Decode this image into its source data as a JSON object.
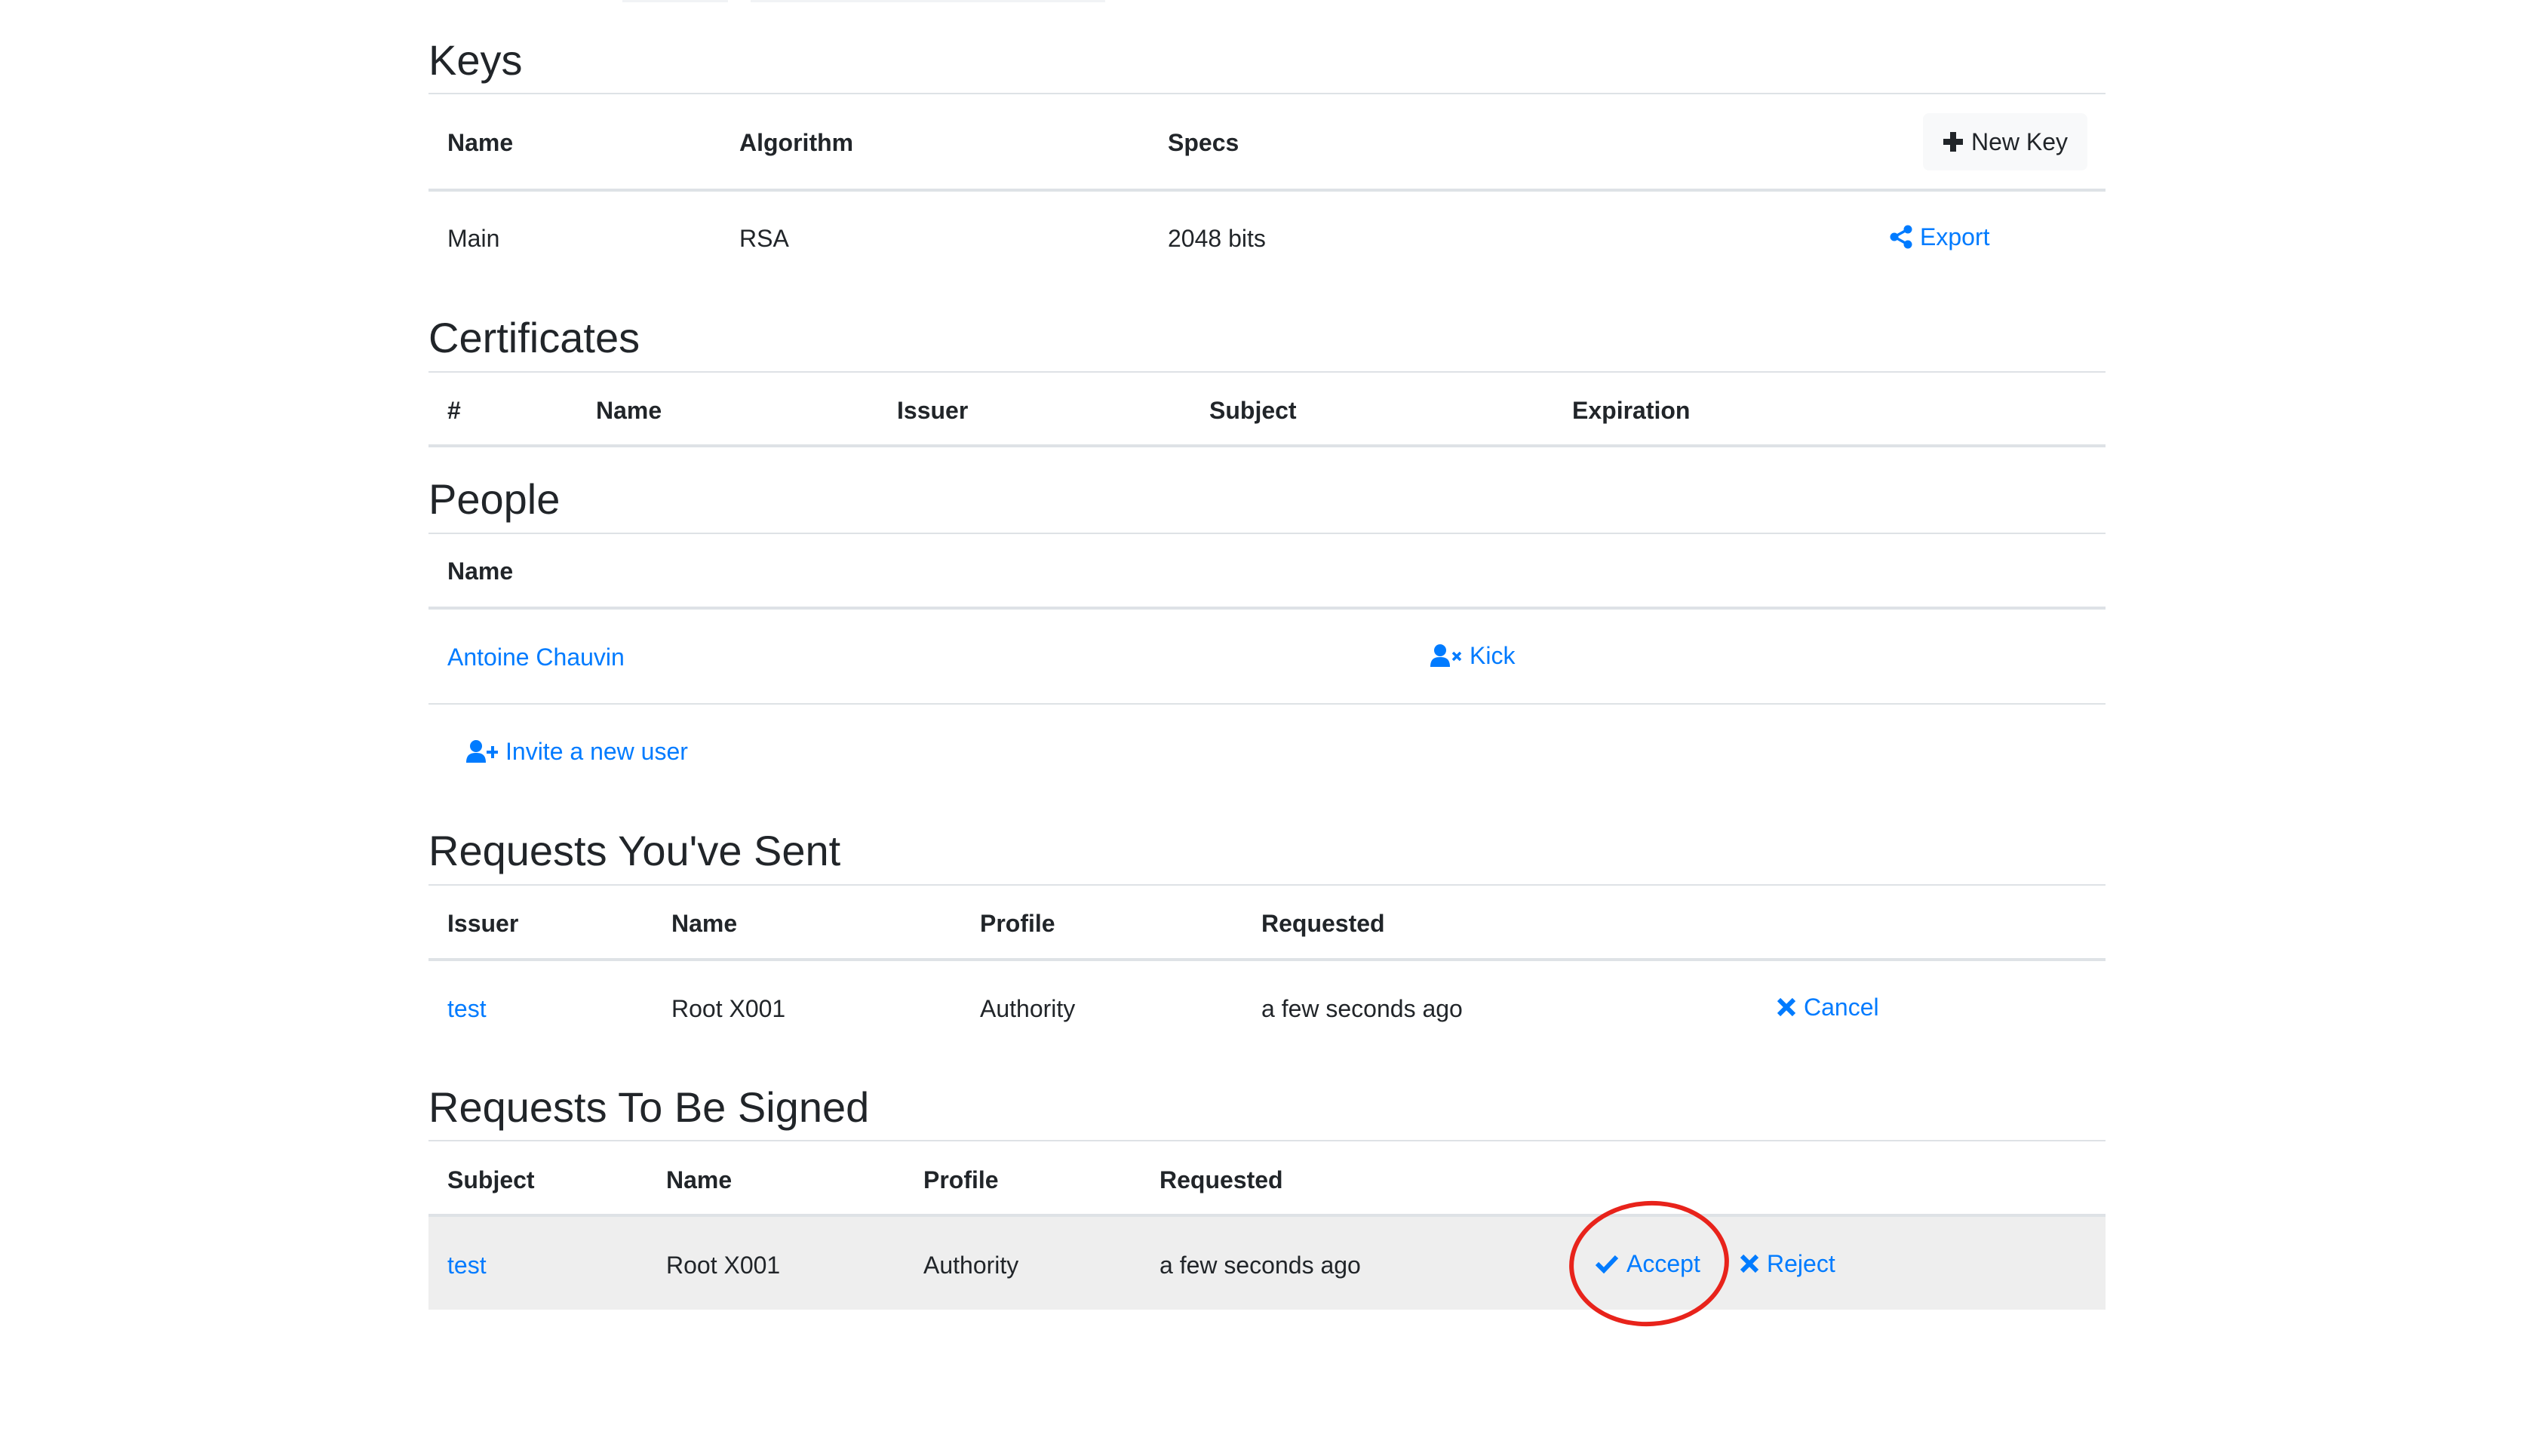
{
  "keys": {
    "title": "Keys",
    "columns": [
      "Name",
      "Algorithm",
      "Specs"
    ],
    "new_key_label": "New Key",
    "rows": [
      {
        "name": "Main",
        "algorithm": "RSA",
        "specs": "2048 bits",
        "action": "Export"
      }
    ]
  },
  "certificates": {
    "title": "Certificates",
    "columns": [
      "#",
      "Name",
      "Issuer",
      "Subject",
      "Expiration"
    ]
  },
  "people": {
    "title": "People",
    "columns": [
      "Name"
    ],
    "rows": [
      {
        "name": "Antoine Chauvin",
        "action": "Kick"
      }
    ],
    "invite_label": "Invite a new user"
  },
  "requests_sent": {
    "title": "Requests You've Sent",
    "columns": [
      "Issuer",
      "Name",
      "Profile",
      "Requested"
    ],
    "rows": [
      {
        "issuer": "test",
        "name": "Root X001",
        "profile": "Authority",
        "requested": "a few seconds ago",
        "action": "Cancel"
      }
    ]
  },
  "requests_to_sign": {
    "title": "Requests To Be Signed",
    "columns": [
      "Subject",
      "Name",
      "Profile",
      "Requested"
    ],
    "rows": [
      {
        "subject": "test",
        "name": "Root X001",
        "profile": "Authority",
        "requested": "a few seconds ago",
        "accept": "Accept",
        "reject": "Reject"
      }
    ]
  },
  "colors": {
    "link": "#007bff",
    "text": "#212529",
    "border": "#dee2e6",
    "highlight_row": "#eeeeee",
    "annotation": "#e8231b"
  }
}
